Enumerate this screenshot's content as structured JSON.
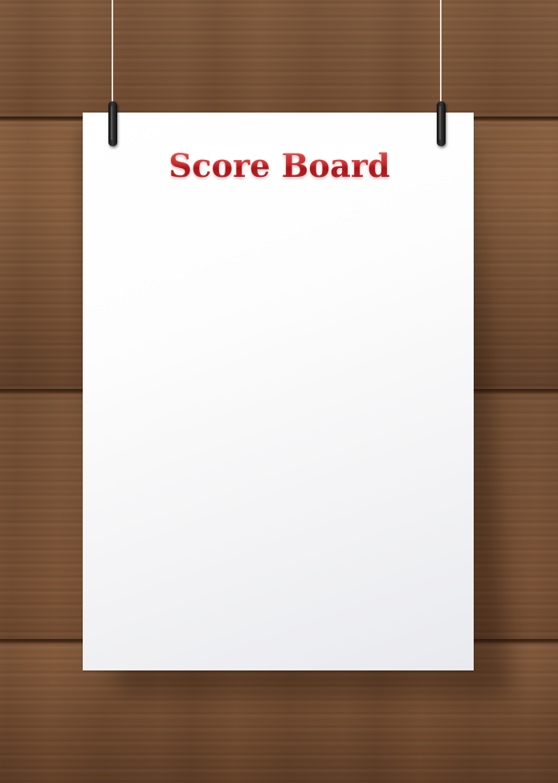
{
  "scoreboard": {
    "title": "Score Board"
  },
  "colors": {
    "title_red": "#d52f33",
    "wood": "#7a5337",
    "paper": "#ffffff",
    "clip": "#1a1a1a"
  }
}
